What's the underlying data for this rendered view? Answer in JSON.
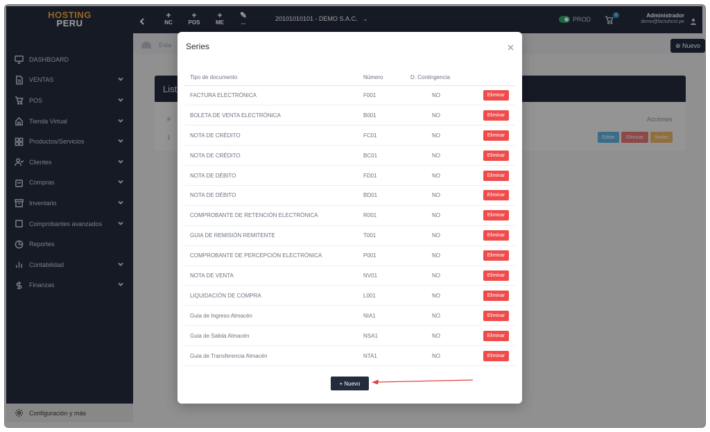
{
  "sidebar": {
    "logo_line1": "HOSTING",
    "logo_line2": "PERU",
    "items": [
      {
        "label": "DASHBOARD",
        "icon": "monitor-icon",
        "has_chevron": false
      },
      {
        "label": "VENTAS",
        "icon": "file-icon",
        "has_chevron": true
      },
      {
        "label": "POS",
        "icon": "cart-icon",
        "has_chevron": true
      },
      {
        "label": "Tienda Virtual",
        "icon": "home-icon",
        "has_chevron": true
      },
      {
        "label": "Productos/Servicios",
        "icon": "grid-icon",
        "has_chevron": true
      },
      {
        "label": "Clientes",
        "icon": "users-icon",
        "has_chevron": true
      },
      {
        "label": "Compras",
        "icon": "bag-icon",
        "has_chevron": true
      },
      {
        "label": "Inventario",
        "icon": "archive-icon",
        "has_chevron": true
      },
      {
        "label": "Comprobantes avanzados",
        "icon": "card-icon",
        "has_chevron": true
      },
      {
        "label": "Reportes",
        "icon": "pie-chart-icon",
        "has_chevron": false
      },
      {
        "label": "Contabilidad",
        "icon": "bar-chart-icon",
        "has_chevron": true
      },
      {
        "label": "Finanzas",
        "icon": "dollar-icon",
        "has_chevron": true
      }
    ],
    "footer_label": "Configuración y más"
  },
  "topbar": {
    "buttons": [
      {
        "label": "NC"
      },
      {
        "label": "POS"
      },
      {
        "label": "ME"
      },
      {
        "label": "..."
      }
    ],
    "company": "20101010101 - DEMO S.A.C.",
    "env_label": "PROD",
    "cart_count": "0",
    "user_name": "Administrador",
    "user_email": "demo@factuhost.pe"
  },
  "background": {
    "breadcrumb": "Esta",
    "new_label": "Nuevo",
    "card_title": "List",
    "hash": "#",
    "row_index": "1",
    "actions_header": "Acciones",
    "btn_edit": "Editar",
    "btn_delete": "Eliminar",
    "btn_series": "Series"
  },
  "modal": {
    "title": "Series",
    "columns": {
      "type": "Tipo de documento",
      "number": "Número",
      "contingency": "D. Contingencia"
    },
    "delete_label": "Eliminar",
    "new_label": "+ Nuevo",
    "rows": [
      {
        "type": "FACTURA ELECTRÓNICA",
        "number": "F001",
        "contingency": "NO"
      },
      {
        "type": "BOLETA DE VENTA ELECTRÓNICA",
        "number": "B001",
        "contingency": "NO"
      },
      {
        "type": "NOTA DE CRÉDITO",
        "number": "FC01",
        "contingency": "NO"
      },
      {
        "type": "NOTA DE CRÉDITO",
        "number": "BC01",
        "contingency": "NO"
      },
      {
        "type": "NOTA DE DÉBITO",
        "number": "FD01",
        "contingency": "NO"
      },
      {
        "type": "NOTA DE DÉBITO",
        "number": "BD01",
        "contingency": "NO"
      },
      {
        "type": "COMPROBANTE DE RETENCIÓN ELECTRÓNICA",
        "number": "R001",
        "contingency": "NO"
      },
      {
        "type": "GUIA DE REMISIÓN REMITENTE",
        "number": "T001",
        "contingency": "NO"
      },
      {
        "type": "COMPROBANTE DE PERCEPCIÓN ELECTRÓNICA",
        "number": "P001",
        "contingency": "NO"
      },
      {
        "type": "NOTA DE VENTA",
        "number": "NV01",
        "contingency": "NO"
      },
      {
        "type": "LIQUIDACIÓN DE COMPRA",
        "number": "L001",
        "contingency": "NO"
      },
      {
        "type": "Guia de Ingreso Almacén",
        "number": "NIA1",
        "contingency": "NO"
      },
      {
        "type": "Guia de Salida Almacén",
        "number": "NSA1",
        "contingency": "NO"
      },
      {
        "type": "Guia de Transferencia Almacén",
        "number": "NTA1",
        "contingency": "NO"
      }
    ]
  },
  "colors": {
    "sidebar_bg": "#232b3d",
    "accent_orange": "#f2a43a",
    "danger": "#ef4b4b",
    "toggle_on": "#2ea66b",
    "arrow": "#e0423f"
  }
}
